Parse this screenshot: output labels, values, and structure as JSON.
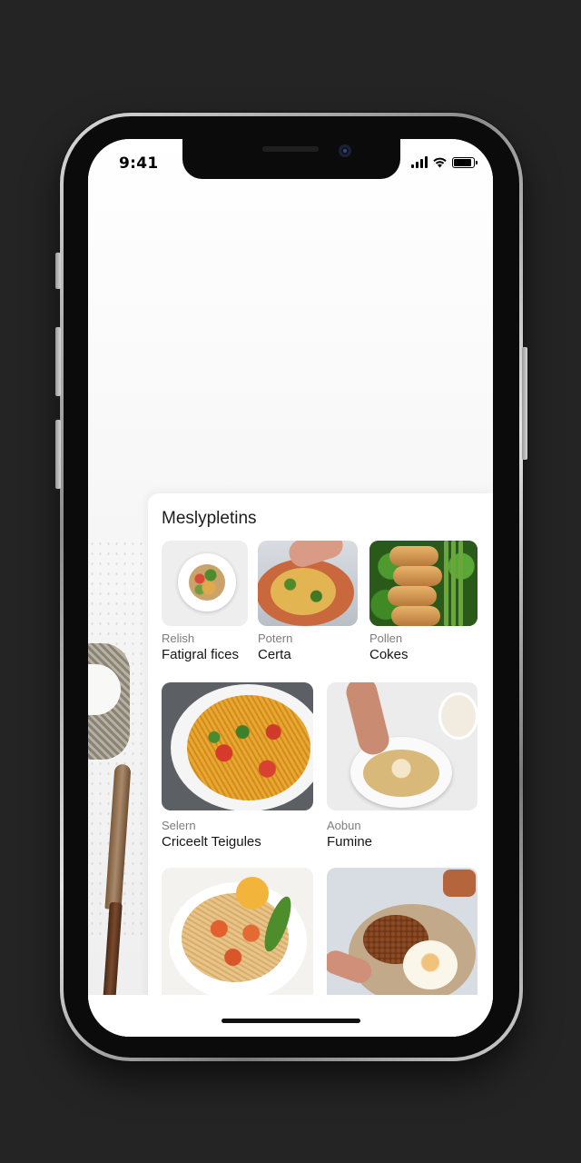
{
  "status_bar": {
    "time": "9:41",
    "signal_bars": 4,
    "battery_level": 0.9
  },
  "icons": {
    "signal": "signal-bars-icon",
    "wifi": "wifi-icon",
    "battery": "battery-icon",
    "camera": "front-camera-icon"
  },
  "section": {
    "title": "Meslypletins",
    "recipes": [
      {
        "category": "Relish",
        "name": "Fatigral fices",
        "image": "veggie-plate-photo"
      },
      {
        "category": "Potern",
        "name": "Certa",
        "image": "crusted-dish-photo"
      },
      {
        "category": "Pollen",
        "name": "Cokes",
        "image": "bread-greens-photo"
      },
      {
        "category": "Selern",
        "name": "Criceelt Teigules",
        "image": "pasta-tomato-photo"
      },
      {
        "category": "Aobun",
        "name": "Fumine",
        "image": "plated-dish-photo"
      },
      {
        "category": "",
        "name": "",
        "image": "tomato-spaghetti-photo"
      },
      {
        "category": "",
        "name": "",
        "image": "minced-meat-egg-photo"
      }
    ]
  },
  "colors": {
    "frame_background": "#242424",
    "screen_background": "#ffffff",
    "text_primary": "#151515",
    "text_secondary": "#7d7d7d"
  }
}
